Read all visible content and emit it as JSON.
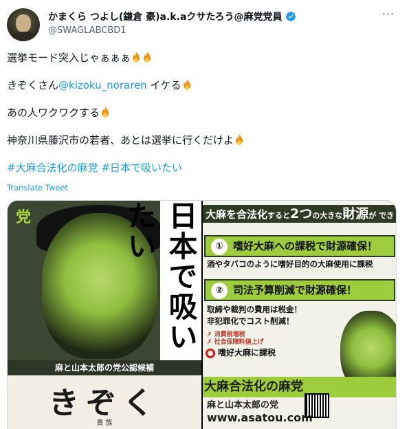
{
  "author": {
    "display_name": "かまくら つよし(鎌倉 豪)a.k.aクサたろう@麻党党員",
    "handle": "@SWAGLABCBD1",
    "verified_icon": "verified-badge-icon",
    "accent": "#1d9bf0"
  },
  "tweet": {
    "line1_text": "選挙モード突入じゃぁぁぁ",
    "line2_prefix": "きぞくさん",
    "line2_mention": "@kizoku_noraren",
    "line2_suffix": " イケる",
    "line3_text": "あの人ワクワクする",
    "line4_text": "神奈川県藤沢市の若者、あとは選挙に行くだけよ",
    "hashtag1": "#大麻合法化の麻党",
    "hashtag2": "#日本で吸いたい",
    "translate_label": "Translate Tweet",
    "emoji": "fire-icon"
  },
  "media": {
    "left": {
      "party_mark": "党",
      "vertical_title": "日本で吸いたい",
      "candidate_strip": "麻と山本太郎の党公認候補",
      "candidate_name": "きぞく",
      "candidate_sub": "貴 族"
    },
    "right": {
      "headline_a": "大麻を合法化",
      "headline_b": "すると",
      "headline_c": "2つ",
      "headline_d": "の大きな",
      "headline_e": "財源",
      "headline_f": "が でき",
      "item1_num": "①",
      "item1_label": "嗜好大麻への課税で財源確保！",
      "item1_detail": "酒やタバコのように嗜好目的の大麻使用に課税",
      "item2_num": "②",
      "item2_label": "司法予算削減で財源確保！",
      "item2_detail1": "取締や裁判の費用は税金！",
      "item2_detail2": "非犯罪化でコスト削減！",
      "tax_line1": "✗ 消費税増税",
      "tax_line2": "✗ 社会保障料値上げ",
      "tax_main": "嗜好大麻に課税",
      "band": "大麻合法化の麻党",
      "party_line": "麻と山本太郎の党",
      "url": "www.asatou.com"
    }
  }
}
